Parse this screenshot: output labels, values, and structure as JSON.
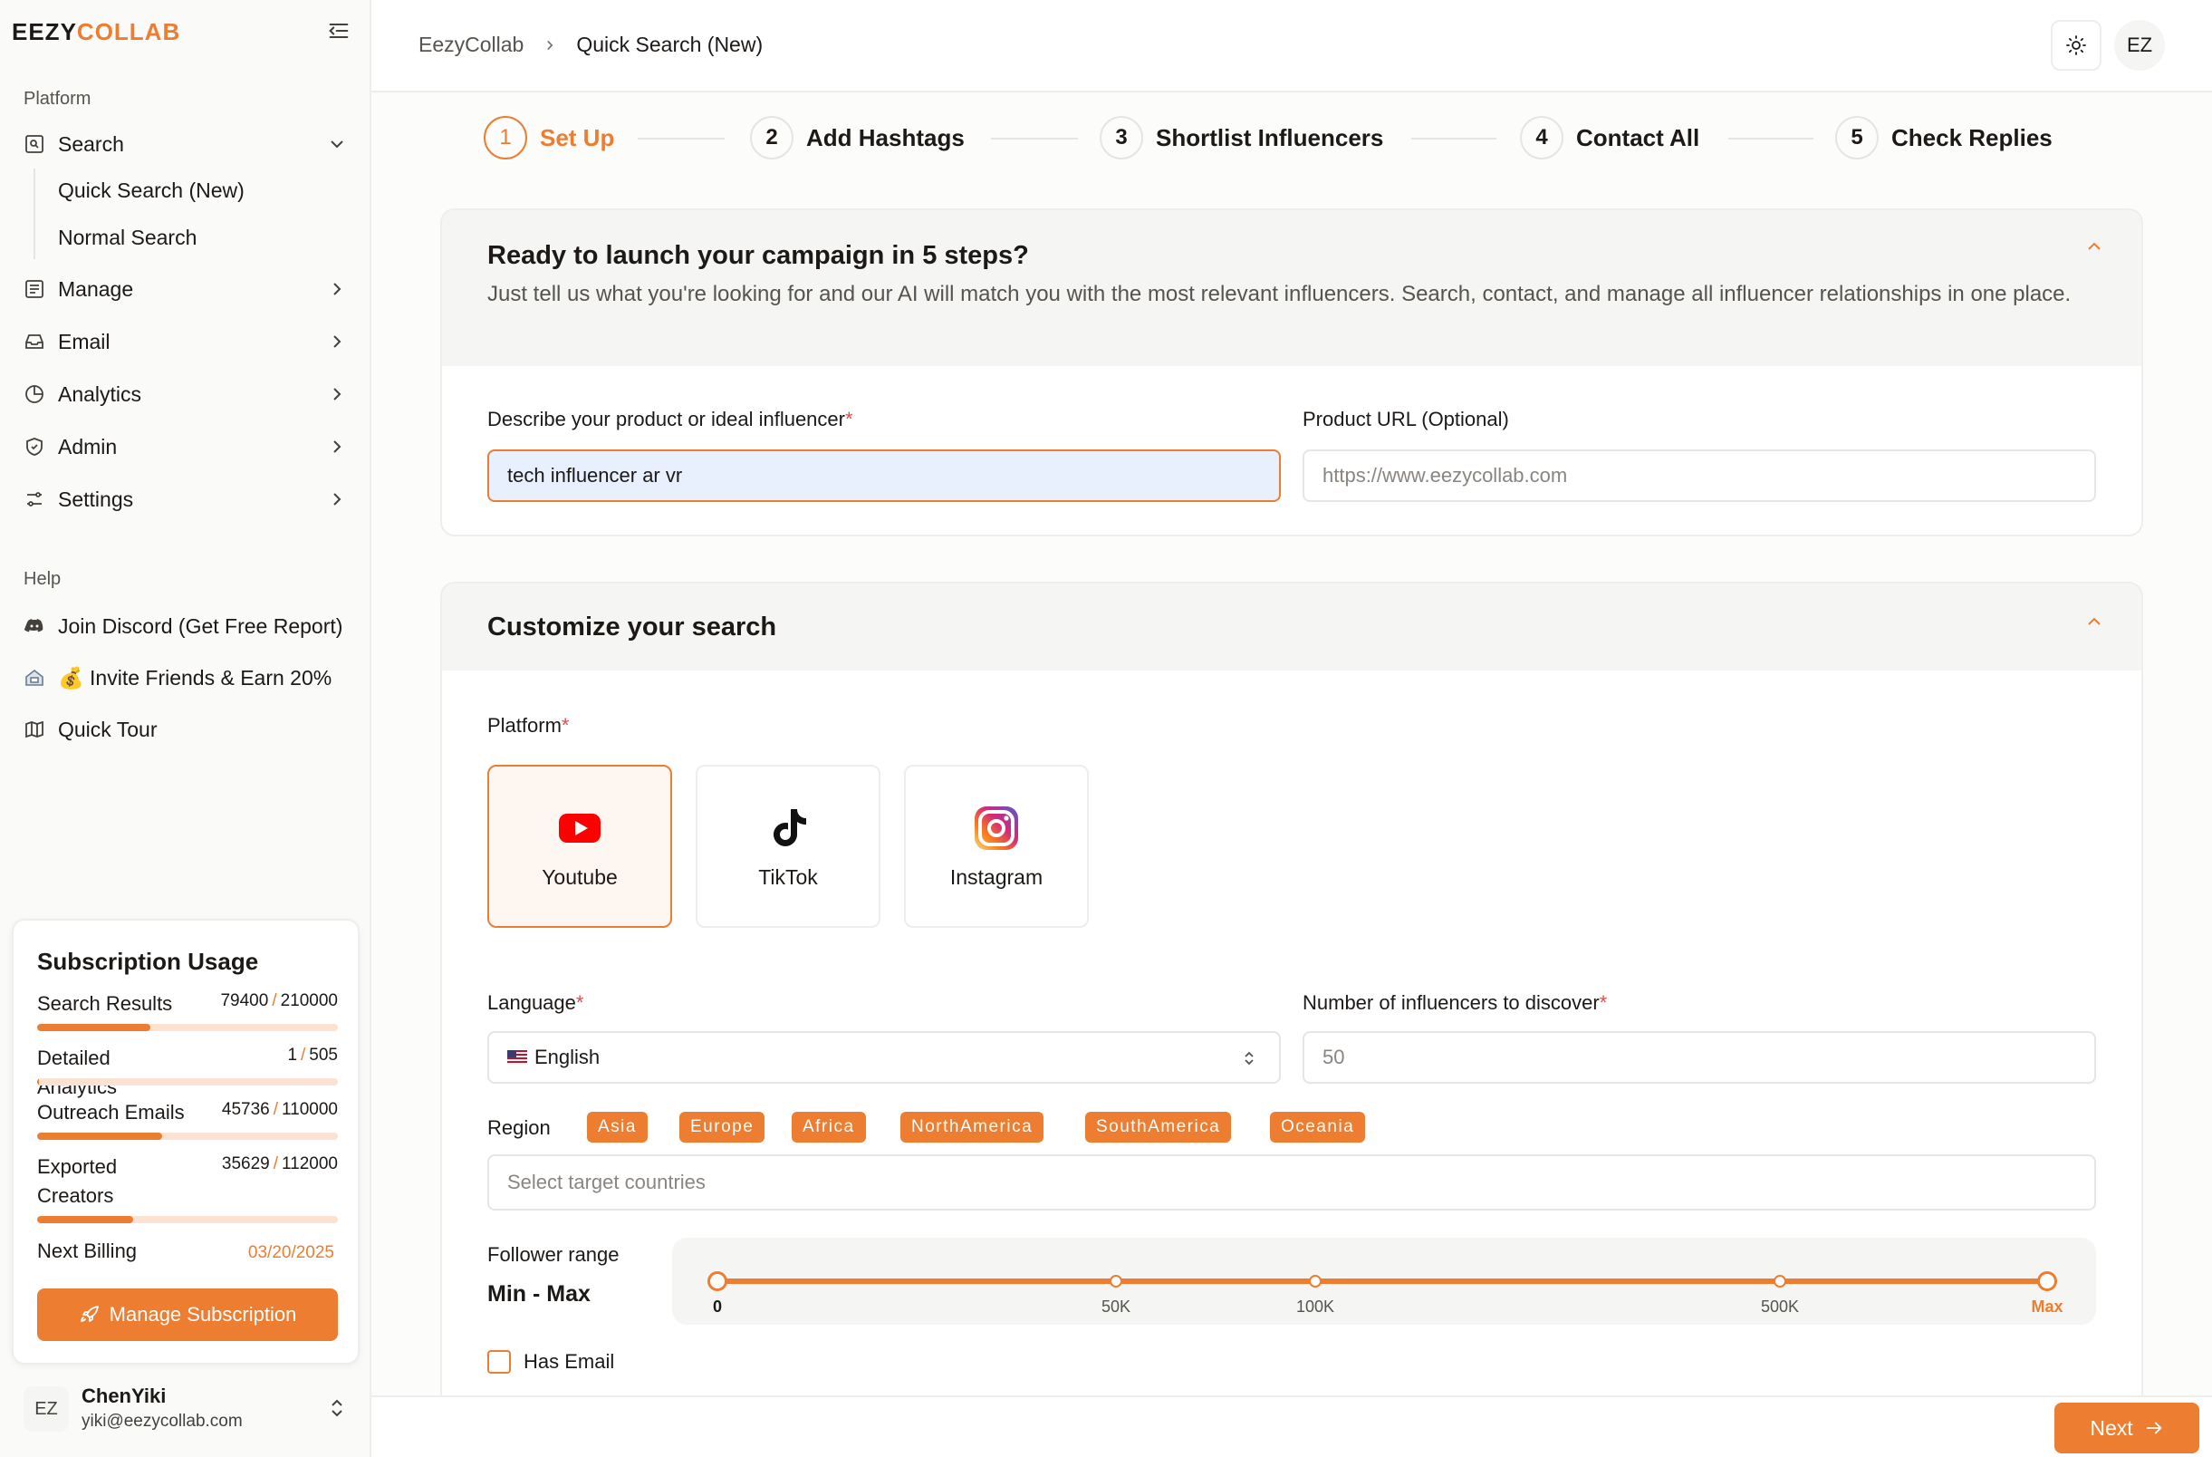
{
  "brand": {
    "part1": "EEZY",
    "part2": "COLLAB"
  },
  "colors": {
    "accent": "#ed7d31",
    "required": "#e5484d"
  },
  "sidebar": {
    "platform_label": "Platform",
    "search": {
      "label": "Search",
      "icon": "search-box-icon"
    },
    "search_sub": [
      "Quick Search (New)",
      "Normal Search"
    ],
    "items": [
      {
        "label": "Manage",
        "icon": "list-icon"
      },
      {
        "label": "Email",
        "icon": "inbox-icon"
      },
      {
        "label": "Analytics",
        "icon": "pie-chart-icon"
      },
      {
        "label": "Admin",
        "icon": "shield-icon"
      },
      {
        "label": "Settings",
        "icon": "sliders-icon"
      }
    ],
    "help_label": "Help",
    "help_items": [
      {
        "label": "Join Discord (Get Free Report)",
        "icon": "discord-icon"
      },
      {
        "label": "💰 Invite Friends & Earn 20%",
        "icon": "invite-icon"
      },
      {
        "label": "Quick Tour",
        "icon": "map-icon"
      }
    ]
  },
  "subscription": {
    "title": "Subscription Usage",
    "rows": [
      {
        "name": "Search Results",
        "used": "79400",
        "total": "210000",
        "fraction": 0.378
      },
      {
        "name": "Detailed Analytics",
        "used": "1",
        "total": "505",
        "fraction": 0.002
      },
      {
        "name": "Outreach Emails",
        "used": "45736",
        "total": "110000",
        "fraction": 0.416
      },
      {
        "name": "Exported Creators",
        "used": "35629",
        "total": "112000",
        "fraction": 0.318
      }
    ],
    "billing_label": "Next Billing",
    "billing_date": "03/20/2025",
    "manage_label": "Manage Subscription"
  },
  "user": {
    "initials": "EZ",
    "name": "ChenYiki",
    "email": "yiki@eezycollab.com"
  },
  "header": {
    "breadcrumb": [
      "EezyCollab",
      "Quick Search (New)"
    ],
    "avatar": "EZ"
  },
  "steps": [
    {
      "num": "1",
      "label": "Set Up",
      "active": true
    },
    {
      "num": "2",
      "label": "Add Hashtags",
      "active": false
    },
    {
      "num": "3",
      "label": "Shortlist Influencers",
      "active": false
    },
    {
      "num": "4",
      "label": "Contact All",
      "active": false
    },
    {
      "num": "5",
      "label": "Check Replies",
      "active": false
    }
  ],
  "intro_card": {
    "title": "Ready to launch your campaign in 5 steps?",
    "description": "Just tell us what you're looking for and our AI will match you with the most relevant influencers. Search, contact, and manage all influencer relationships in one place.",
    "describe_label": "Describe your product or ideal influencer",
    "describe_value": "tech influencer ar vr",
    "url_label": "Product URL (Optional)",
    "url_placeholder": "https://www.eezycollab.com"
  },
  "customize_card": {
    "title": "Customize your search",
    "platform_label": "Platform",
    "platforms": [
      {
        "name": "Youtube",
        "selected": true
      },
      {
        "name": "TikTok",
        "selected": false
      },
      {
        "name": "Instagram",
        "selected": false
      }
    ],
    "language_label": "Language",
    "language_value": "English",
    "count_label": "Number of influencers to discover",
    "count_placeholder": "50",
    "region_label": "Region",
    "regions": [
      "Asia",
      "Europe",
      "Africa",
      "NorthAmerica",
      "SouthAmerica",
      "Oceania"
    ],
    "countries_placeholder": "Select target countries",
    "follower_label": "Follower range",
    "follower_value": "Min - Max",
    "ticks": [
      "0",
      "50K",
      "100K",
      "500K",
      "Max"
    ],
    "has_email_label": "Has Email",
    "has_email_checked": false
  },
  "footer": {
    "next_label": "Next"
  }
}
